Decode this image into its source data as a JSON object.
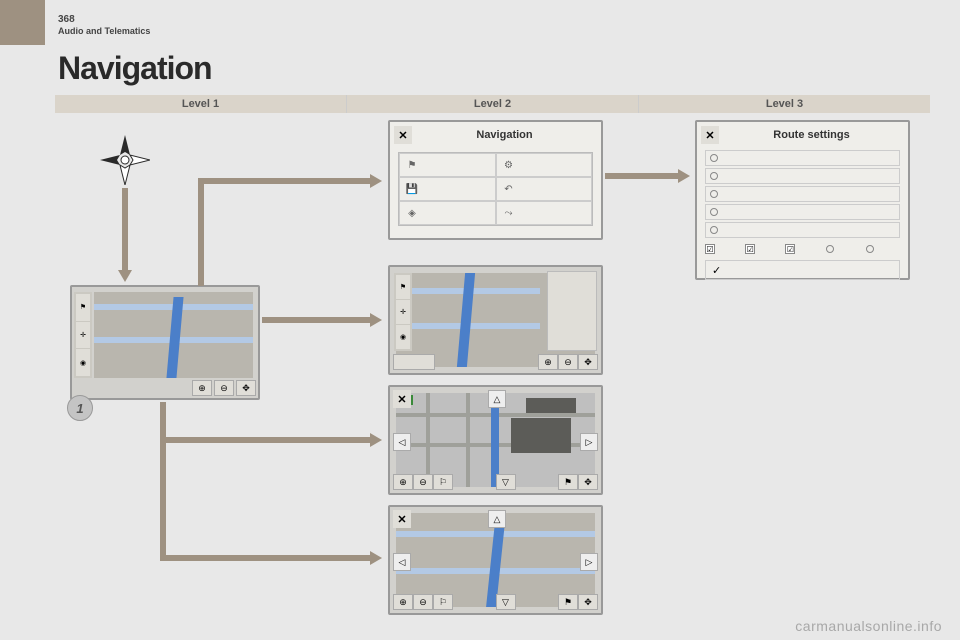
{
  "page": {
    "number": "368",
    "section": "Audio and Telematics",
    "title": "Navigation"
  },
  "levels": {
    "l1": "Level 1",
    "l2": "Level 2",
    "l3": "Level 3"
  },
  "badge": {
    "num": "1"
  },
  "main_screen": {
    "zoom_in": "⊕",
    "zoom_out": "⊖",
    "orient": "✥",
    "sidebar": {
      "flag": "⚑",
      "compass": "✛",
      "loc": "◉"
    }
  },
  "nav_panel": {
    "close": "✕",
    "title": "Navigation",
    "items": {
      "r1c1": {
        "icon": "⚑",
        "label": ""
      },
      "r1c2": {
        "icon": "⚙",
        "label": ""
      },
      "r2c1": {
        "icon": "💾",
        "label": ""
      },
      "r2c2": {
        "icon": "↶",
        "label": ""
      },
      "r3c1": {
        "icon": "◈",
        "label": ""
      },
      "r3c2": {
        "icon": "⤳",
        "label": ""
      }
    }
  },
  "route_panel": {
    "close": "✕",
    "title": "Route settings",
    "options": [
      "",
      "",
      "",
      "",
      ""
    ],
    "check": "☑",
    "confirm": "✓"
  },
  "screen2": {
    "close": "",
    "zoom_in": "⊕",
    "zoom_out": "⊖",
    "orient": "✥"
  },
  "screen3": {
    "close": "✕",
    "up": "△",
    "down": "▽",
    "left": "◁",
    "right": "▷",
    "zoom_in": "⊕",
    "zoom_out": "⊖",
    "flag": "⚑",
    "poi": "⚐",
    "orient": "✥"
  },
  "screen4": {
    "close": "✕",
    "up": "△",
    "down": "▽",
    "left": "◁",
    "right": "▷",
    "zoom_in": "⊕",
    "zoom_out": "⊖",
    "flag": "⚑",
    "poi": "⚐",
    "orient": "✥"
  },
  "watermark": "carmanualsonline.info"
}
